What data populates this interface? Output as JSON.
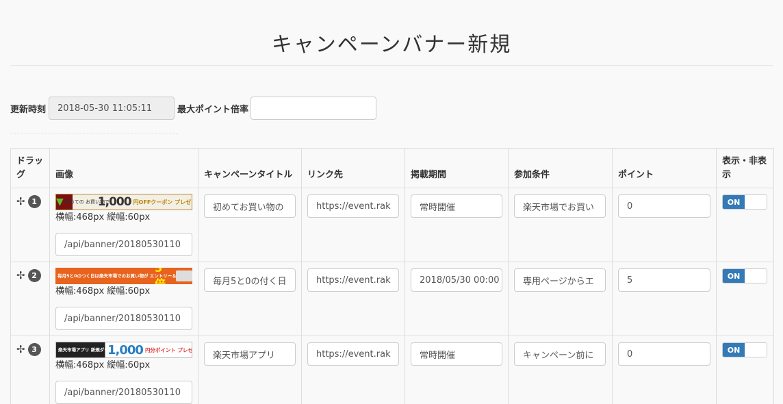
{
  "page": {
    "title": "キャンペーンバナー新規"
  },
  "meta": {
    "updated_label": "更新時刻",
    "updated_value": "2018-05-30 11:05:11",
    "max_point_label": "最大ポイント倍率",
    "max_point_value": ""
  },
  "table": {
    "headers": {
      "drag": "ドラッグ",
      "image": "画像",
      "title": "キャンペーンタイトル",
      "link": "リンク先",
      "period": "掲載期間",
      "condition": "参加条件",
      "point": "ポイント",
      "visible": "表示・非表示"
    },
    "rows": [
      {
        "num": "1",
        "size": "横幅:468px 縦幅:60px",
        "path": "/api/banner/20180530110",
        "title": "初めてお買い物の",
        "link": "https://event.rak",
        "period": "常時開催",
        "condition": "楽天市場でお買い",
        "point": "0",
        "toggle": "ON",
        "banner": {
          "sub": "初めての お買い物で",
          "big": "1,000",
          "small": "円OFFクーポン プレゼント"
        }
      },
      {
        "num": "2",
        "size": "横幅:468px 縦幅:60px",
        "path": "/api/banner/20180530110",
        "title": "毎月5と0の付く日",
        "link": "https://event.rak",
        "period": "2018/05/30 00:00",
        "condition": "専用ページからエ",
        "point": "5",
        "toggle": "ON",
        "banner": {
          "sub": "毎月5と0のつく日は楽天市場でのお買い物が エントリー＆楽天カードご利用でポイント",
          "big": "5倍"
        }
      },
      {
        "num": "3",
        "size": "横幅:468px 縦幅:60px",
        "path": "/api/banner/20180530110",
        "title": "楽天市場アプリ",
        "link": "https://event.rak",
        "period": "常時開催",
        "condition": "キャンペーン前に",
        "point": "0",
        "toggle": "ON",
        "banner": {
          "sub": "楽天市場アプリ 新規ダウンロード キャンペーン",
          "big": "1,000",
          "small": "円分ポイント プレゼント"
        }
      }
    ]
  }
}
